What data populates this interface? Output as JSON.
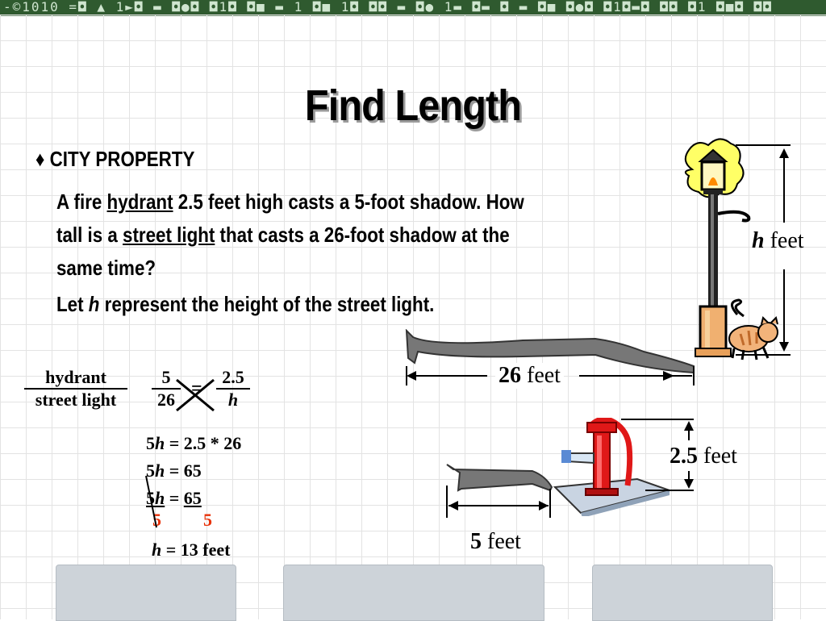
{
  "header": {
    "strip_text": "-©1010 =◘ ▲ 1►◘ ▬ ◘●◘ ◘1◘ ◘■ ▬ 1 ◘■ 1◘ ◘◘ ▬ ◘● 1▬ ◘▬ ◘ ▬ ◘■ ◘●◘ ◘1◘▬◘ ◘◘ ◘1 ◘■◘ ◘◘"
  },
  "title": "Find Length",
  "bullet": {
    "symbol": "♦",
    "text": "CITY PROPERTY"
  },
  "problem": {
    "t1": "A fire ",
    "hydrant": "hydrant",
    "t2": " 2.5 feet high casts a 5-foot shadow. How tall is a ",
    "street_light": "street light",
    "t3": " that casts a 26-foot shadow at the same time?"
  },
  "let": {
    "t1": "Let ",
    "var": "h",
    "t2": " represent the height of the street light."
  },
  "proportion": {
    "left_num": "hydrant",
    "left_den": "street light",
    "r1_num": "5",
    "r1_den": "26",
    "eq": "=",
    "r2_num": "2.5",
    "r2_den": "h"
  },
  "steps": {
    "s1": {
      "a": "5",
      "b": "h",
      "c": " = 2.5 * 26"
    },
    "s2": {
      "a": "5",
      "b": "h",
      "c": " = 65"
    },
    "s3": {
      "a": "5",
      "b": "h",
      "c": " = ",
      "d": "65"
    },
    "s4": {
      "l": "5",
      "r": "5"
    },
    "s5": {
      "a": "h",
      "c": " = 13 feet"
    }
  },
  "labels": {
    "h": {
      "v": "h",
      "u": " feet"
    },
    "shadow_26": {
      "v": "26",
      "u": " feet"
    },
    "hyd_h": {
      "v": "2.5",
      "u": " feet"
    },
    "shadow_5": {
      "v": "5",
      "u": " feet"
    }
  }
}
